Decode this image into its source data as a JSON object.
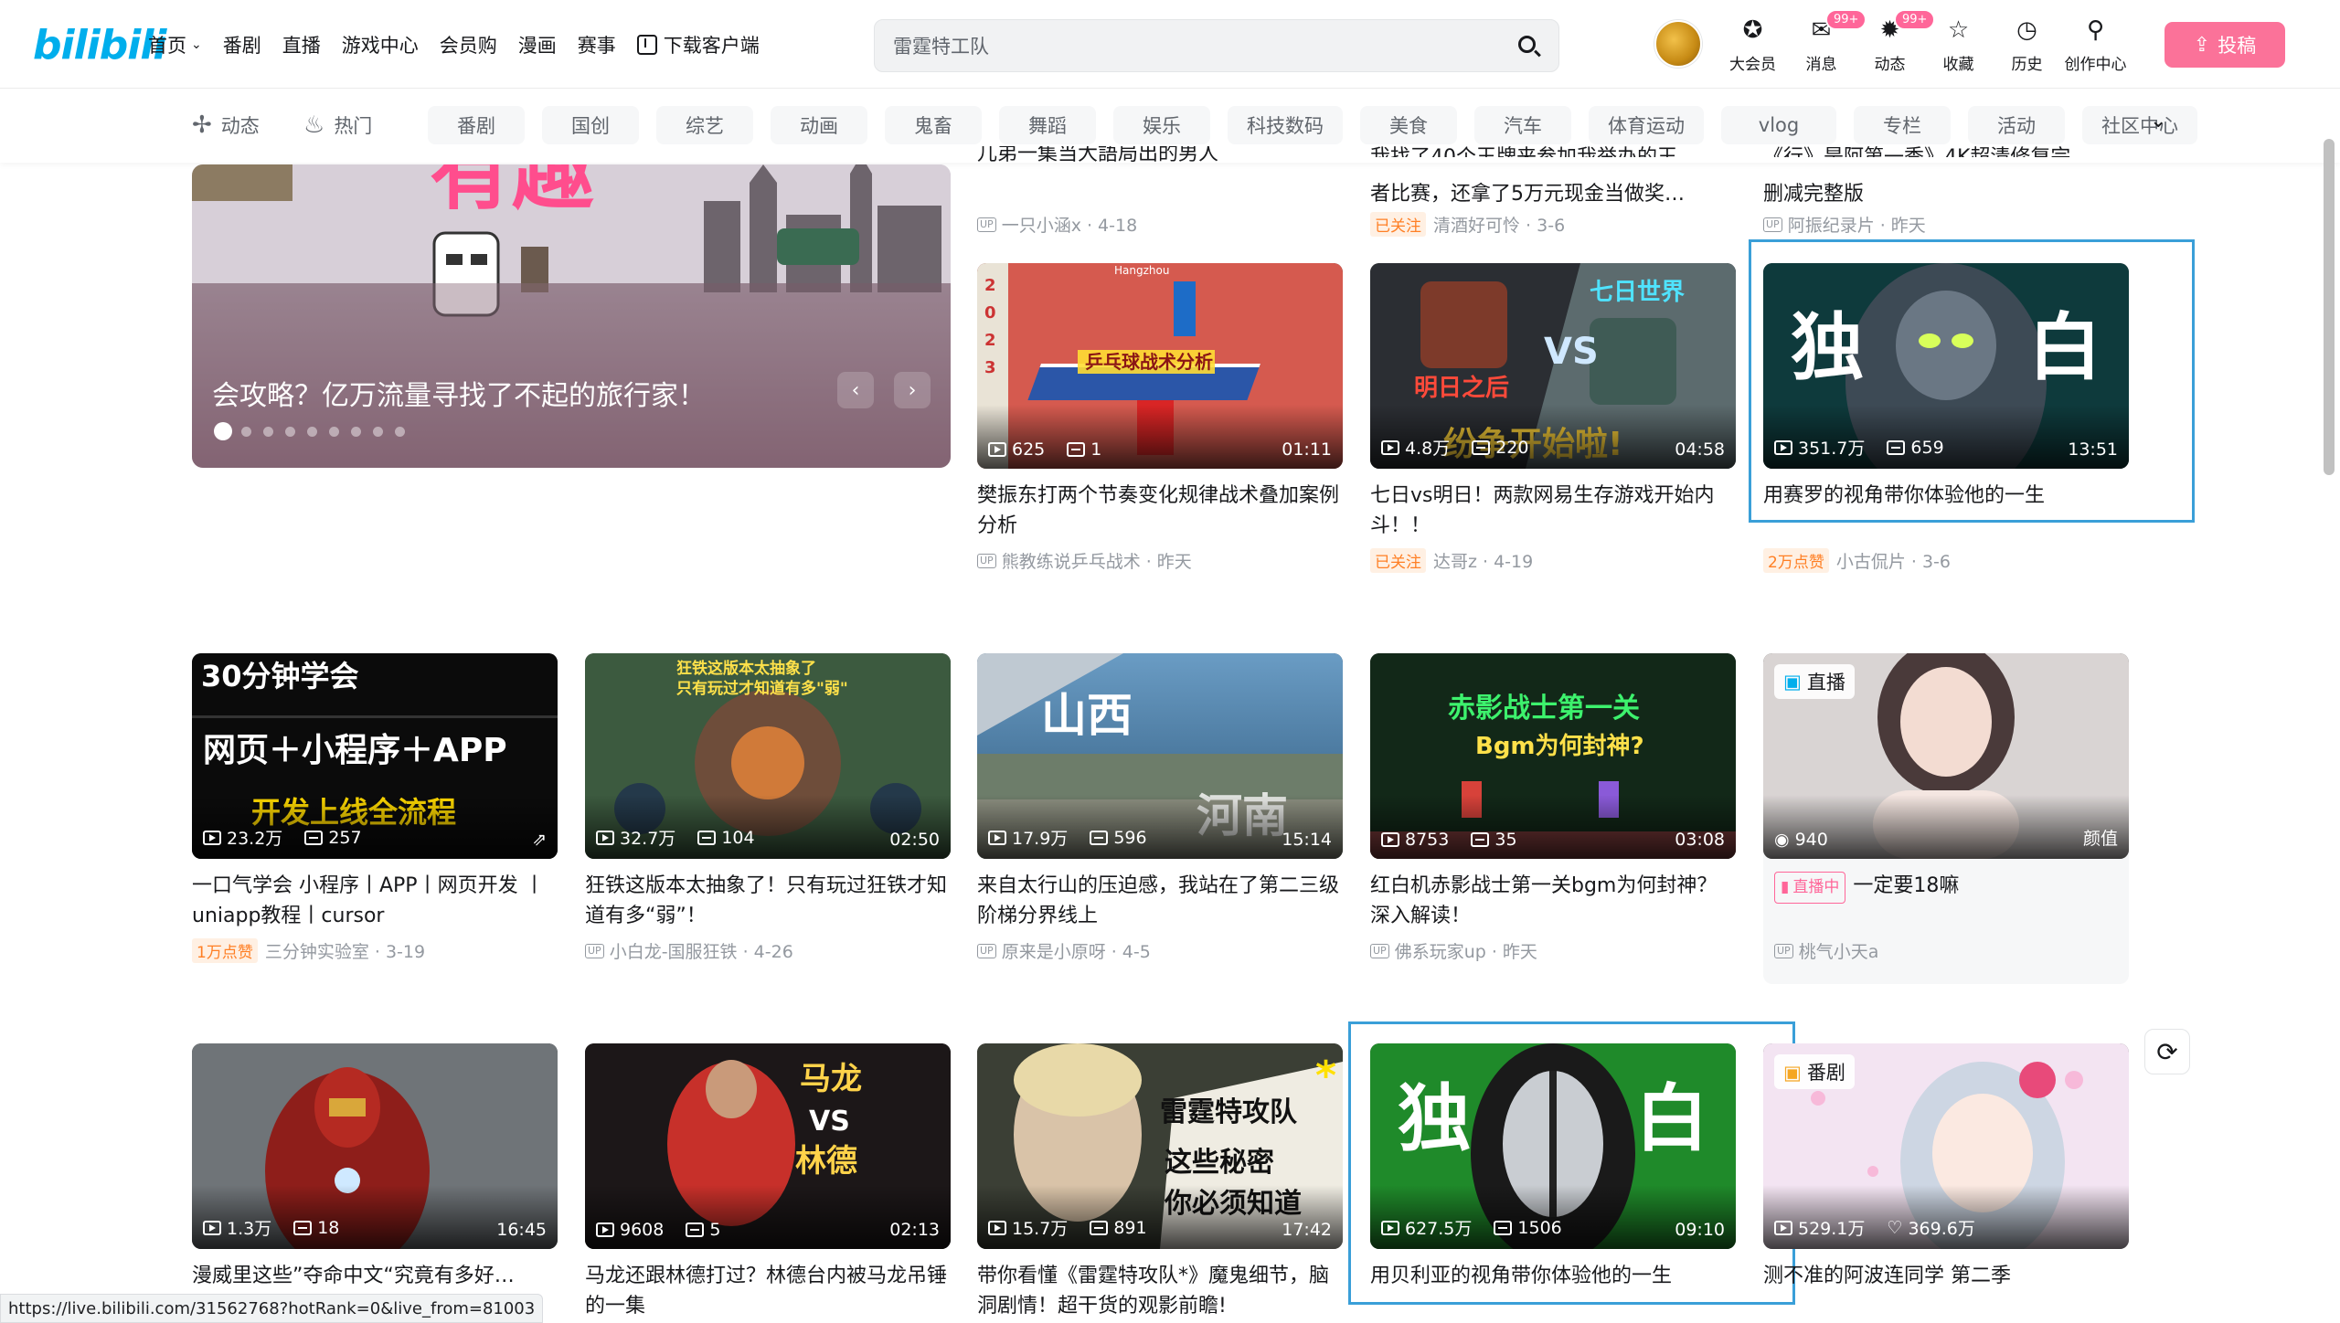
{
  "header": {
    "logo": "bilibili",
    "nav": [
      {
        "label": "首页",
        "chevron": true
      },
      {
        "label": "番剧"
      },
      {
        "label": "直播"
      },
      {
        "label": "游戏中心"
      },
      {
        "label": "会员购"
      },
      {
        "label": "漫画"
      },
      {
        "label": "赛事"
      },
      {
        "label": "下载客户端",
        "icon": "download-icon"
      }
    ],
    "search": {
      "placeholder": "雷霆特工队"
    },
    "icons": [
      {
        "label": "大会员",
        "icon": "vip-icon",
        "glyph": "✪"
      },
      {
        "label": "消息",
        "icon": "message-icon",
        "glyph": "✉",
        "badge": "99+"
      },
      {
        "label": "动态",
        "icon": "dynamic-icon",
        "glyph": "✹",
        "badge": "99+"
      },
      {
        "label": "收藏",
        "icon": "star-icon",
        "glyph": "☆"
      },
      {
        "label": "历史",
        "icon": "clock-icon",
        "glyph": "◷"
      },
      {
        "label": "创作中心",
        "icon": "bulb-icon",
        "glyph": "⚲"
      }
    ],
    "upload": "投稿"
  },
  "subnav": {
    "left": [
      {
        "label": "动态",
        "glyph": "✢"
      },
      {
        "label": "热门",
        "glyph": "♨"
      }
    ],
    "chips": [
      "番剧",
      "国创",
      "综艺",
      "动画",
      "鬼畜",
      "舞蹈",
      "娱乐",
      "科技数码",
      "美食",
      "汽车",
      "体育运动",
      "vlog",
      "专栏",
      "活动",
      "社区中心"
    ]
  },
  "banner": {
    "title": "会攻略？亿万流量寻找了不起的旅行家！",
    "dots": 9
  },
  "top_row": [
    {
      "title": "儿弟一集当大語局出的男人",
      "meta": "一只小涵x · 4-18"
    },
    {
      "title": "者比赛，还拿了5万元现金当做奖…",
      "tag": "已关注",
      "meta": "清酒好可怜 · 3-6"
    },
    {
      "title": "删减完整版",
      "meta": "阿振纪录片 · 昨天"
    }
  ],
  "rows": [
    [
      {
        "views": "625",
        "danmaku": "1",
        "duration": "01:11",
        "title": "樊振东打两个节奏变化规律战术叠加案例分析",
        "meta": "熊教练说乒乓战术 · 昨天",
        "up": true,
        "thumb": "pingpong"
      },
      {
        "views": "4.8万",
        "danmaku": "220",
        "duration": "04:58",
        "title": "七日vs明日！两款网易生存游戏开始内斗！！",
        "meta": "达哥z · 4-19",
        "tag": "已关注",
        "thumb": "game"
      },
      {
        "views": "351.7万",
        "danmaku": "659",
        "duration": "13:51",
        "title": "用赛罗的视角带你体验他的一生",
        "meta": "小古侃片 · 3-6",
        "tag": "2万点赞",
        "thumb": "zero",
        "highlight": true
      }
    ],
    [
      {
        "views": "23.2万",
        "danmaku": "257",
        "duration": "",
        "title": "一口气学会 小程序丨APP丨网页开发 丨uniapp教程丨cursor",
        "meta": "三分钟实验室 · 3-19",
        "tag": "1万点赞",
        "thumb": "code"
      },
      {
        "views": "32.7万",
        "danmaku": "104",
        "duration": "02:50",
        "title": "狂铁这版本太抽象了！只有玩过狂铁才知道有多“弱”！",
        "meta": "小白龙-国服狂铁 · 4-26",
        "up": true,
        "thumb": "moba"
      },
      {
        "views": "17.9万",
        "danmaku": "596",
        "duration": "15:14",
        "title": "来自太行山的压迫感，我站在了第二三级阶梯分界线上",
        "meta": "原来是小原呀 · 4-5",
        "up": true,
        "thumb": "aerial"
      },
      {
        "views": "8753",
        "danmaku": "35",
        "duration": "03:08",
        "title": "红白机赤影战士第一关bgm为何封神？深入解读！",
        "meta": "佛系玩家up · 昨天",
        "up": true,
        "thumb": "retro"
      },
      {
        "live": true,
        "live_label": "直播",
        "viewers": "940",
        "area": "颜值",
        "live_tag": "直播中",
        "title": "一定要18嘛",
        "meta": "桃气小天a",
        "up": true,
        "thumb": "live"
      }
    ],
    [
      {
        "views": "1.3万",
        "danmaku": "18",
        "duration": "16:45",
        "title": "漫威里这些”夺命中文“究竟有多好…",
        "meta": "",
        "thumb": "ironman"
      },
      {
        "views": "9608",
        "danmaku": "5",
        "duration": "02:13",
        "title": "马龙还跟林德打过？林德台内被马龙吊锤的一集",
        "meta": "",
        "thumb": "malong"
      },
      {
        "views": "15.7万",
        "danmaku": "891",
        "duration": "17:42",
        "title": "带你看懂《雷霆特攻队*》魔鬼细节，脑洞剧情！超干货的观影前瞻!",
        "meta": "",
        "thumb": "thunder"
      },
      {
        "views": "627.5万",
        "danmaku": "1506",
        "duration": "09:10",
        "title": "用贝利亚的视角带你体验他的一生",
        "meta": "",
        "thumb": "belial",
        "highlight": true
      },
      {
        "views": "529.1万",
        "likes": "369.6万",
        "duration": "",
        "title": "测不准的阿波连同学 第二季",
        "meta": "",
        "thumb": "anime",
        "cat": "番剧"
      }
    ]
  ],
  "status_url": "https://live.bilibili.com/31562768?hotRank=0&live_from=81003",
  "colors": {
    "brand": "#00aeec",
    "pink": "#fb7299",
    "highlight": "#3a9fd8"
  }
}
